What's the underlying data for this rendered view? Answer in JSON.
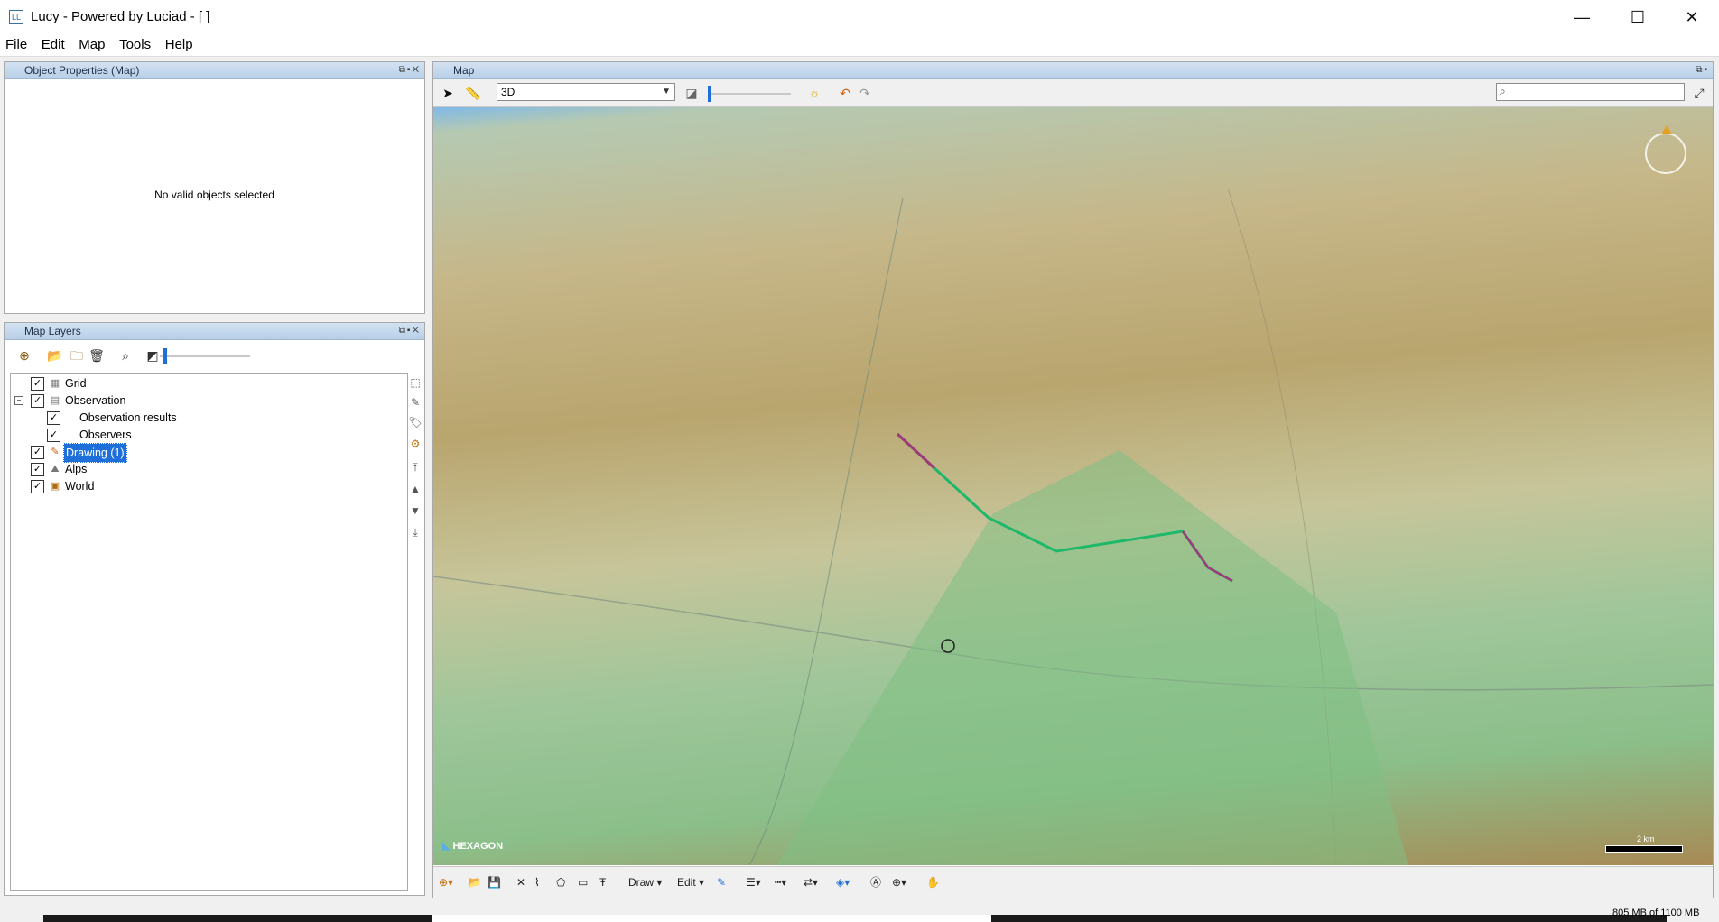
{
  "window": {
    "title": "Lucy - Powered by Luciad - [ ]",
    "app_icon": "LL",
    "minimize": "—",
    "maximize": "☐",
    "close": "✕"
  },
  "menu": [
    "File",
    "Edit",
    "Map",
    "Tools",
    "Help"
  ],
  "object_properties": {
    "title": "Object Properties (Map)",
    "empty_message": "No valid objects selected"
  },
  "map_layers": {
    "title": "Map Layers",
    "items": [
      {
        "label": "Grid",
        "checked": true,
        "icon": "grid-icon"
      },
      {
        "label": "Observation",
        "checked": true,
        "icon": "layer-group-icon",
        "expanded": true
      },
      {
        "label": "Observation results",
        "checked": true,
        "child": true
      },
      {
        "label": "Observers",
        "checked": true,
        "child": true
      },
      {
        "label": "Drawing (1)",
        "checked": true,
        "icon": "drawing-icon",
        "selected": true
      },
      {
        "label": "Alps",
        "checked": true,
        "icon": "elevation-icon"
      },
      {
        "label": "World",
        "checked": true,
        "icon": "raster-icon"
      }
    ]
  },
  "map": {
    "title": "Map",
    "view_mode": "3D",
    "logo": "HEXAGON",
    "scale": "2 km",
    "bottom_toolbar": {
      "draw": "Draw",
      "edit": "Edit"
    }
  },
  "status": {
    "memory": "805 MB of 1100 MB",
    "memory_fraction": 0.73
  }
}
